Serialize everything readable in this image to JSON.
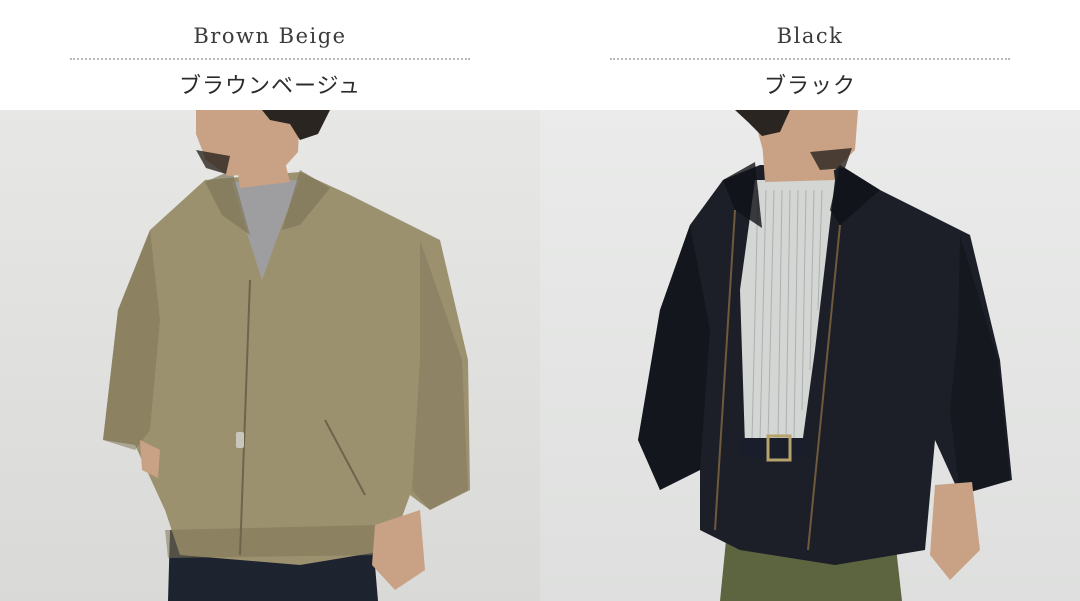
{
  "variants": [
    {
      "name_en": "Brown Beige",
      "name_jp": "ブラウンベージュ",
      "colors": {
        "background_top": "#e7e7e5",
        "background_bottom": "#d9d9d7",
        "jacket": "#9c916f",
        "jacket_shadow": "#7f7658",
        "inner_shirt": "#9e9ea0",
        "pants": "#1e2330",
        "skin": "#c9a184",
        "hair": "#2b2521"
      }
    },
    {
      "name_en": "Black",
      "name_jp": "ブラック",
      "colors": {
        "background_top": "#eaebea",
        "background_bottom": "#dedfde",
        "jacket": "#1c1f28",
        "jacket_shadow": "#0f1117",
        "inner_shirt": "#d4d6d3",
        "pants": "#5d6440",
        "skin": "#c9a184",
        "hair": "#2b2521",
        "belt": "#1a1d2a",
        "buckle": "#b5a36b"
      }
    }
  ]
}
